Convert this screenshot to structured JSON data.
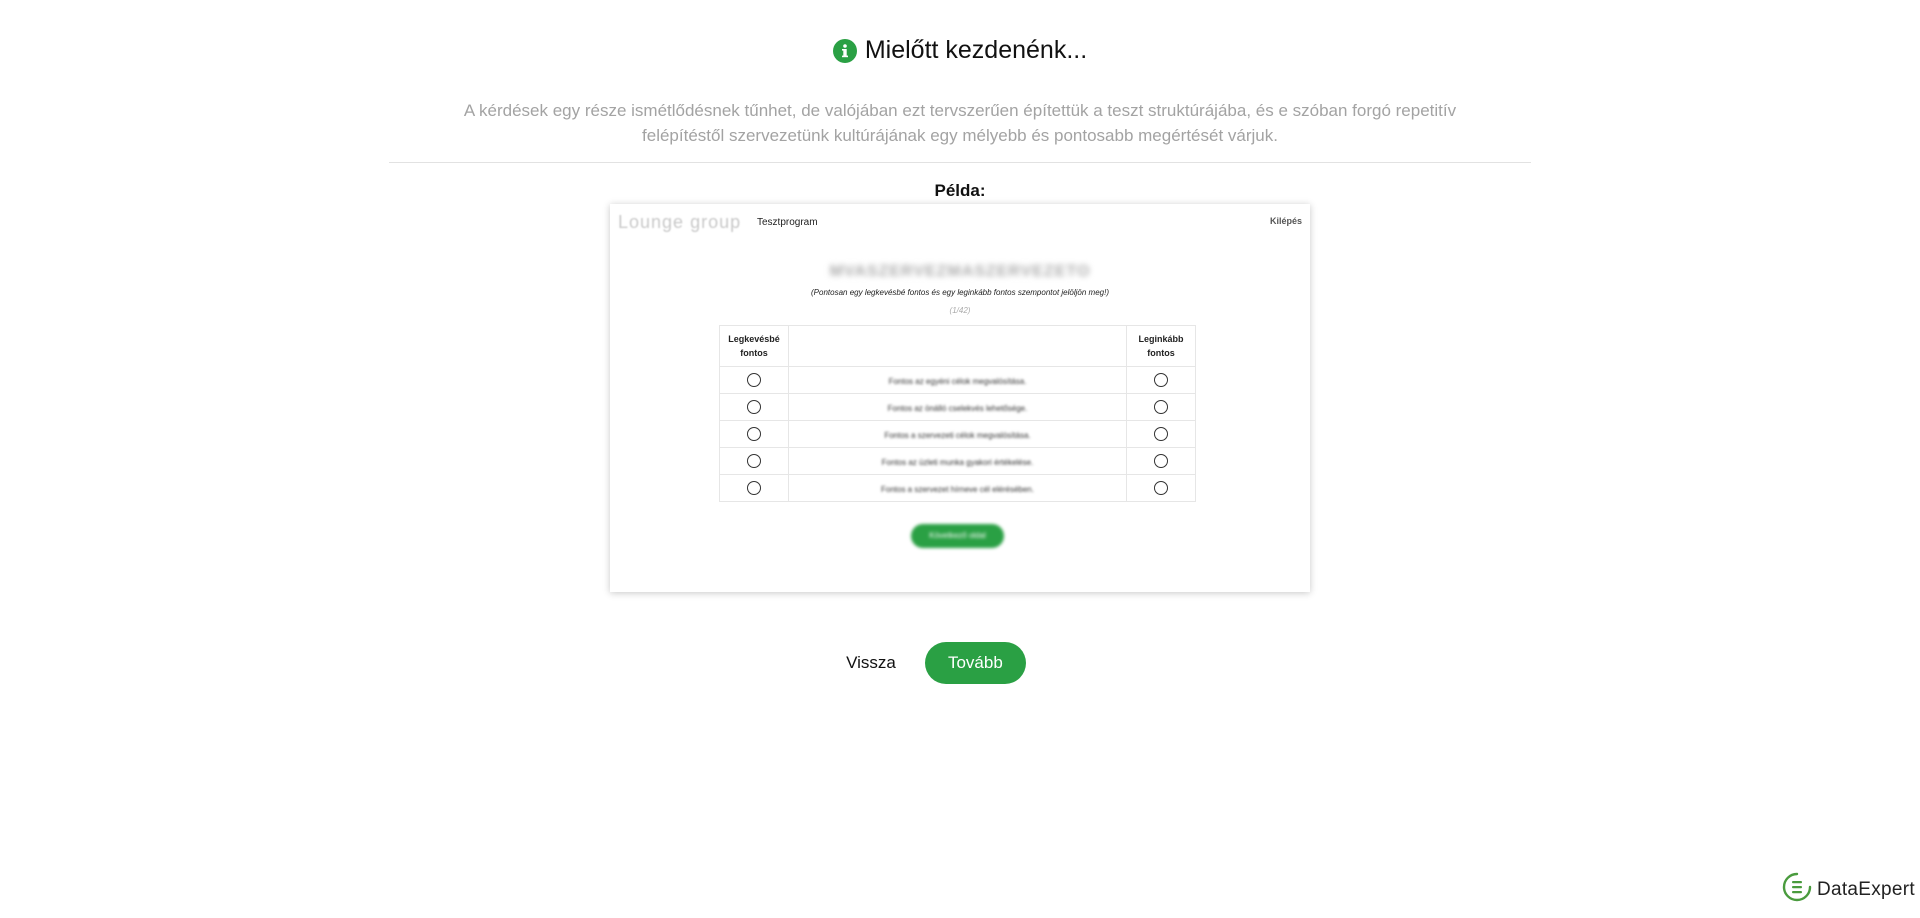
{
  "header": {
    "title": "Mielőtt kezdenénk...",
    "icon": "info-icon",
    "accent_color": "#2aa044"
  },
  "description": "A kérdések egy része ismétlődésnek tűnhet, de valójában ezt tervszerűen építettük a teszt struktúrájába, és e szóban forgó repetitív felépítéstől szervezetünk kultúrájának egy mélyebb és pontosabb megértését várjuk.",
  "example_label": "Példa:",
  "preview": {
    "logo_text": "Lounge group",
    "program_label": "Tesztprogram",
    "exit_label": "Kilépés",
    "heading": "MVASZERVEZMASZERVEZETO",
    "instruction": "(Pontosan egy legkevésbé fontos és egy leginkább fontos szempontot jelöljön meg!)",
    "counter": "(1/42)",
    "columns": {
      "least": "Legkevésbé fontos",
      "most": "Leginkább fontos"
    },
    "statements": [
      "Fontos az egyéni célok megvalósítása.",
      "Fontos az önálló cselekvés lehetősége.",
      "Fontos a szervezeti célok megvalósítása.",
      "Fontos az üzleti munka gyakori értékelése.",
      "Fontos a szervezet hírneve cél elérésében."
    ],
    "next_button": "Következő oldal"
  },
  "nav": {
    "back_label": "Vissza",
    "next_label": "Tovább"
  },
  "brand": {
    "name": "DataExpert",
    "icon": "dataexpert-logo-icon"
  }
}
